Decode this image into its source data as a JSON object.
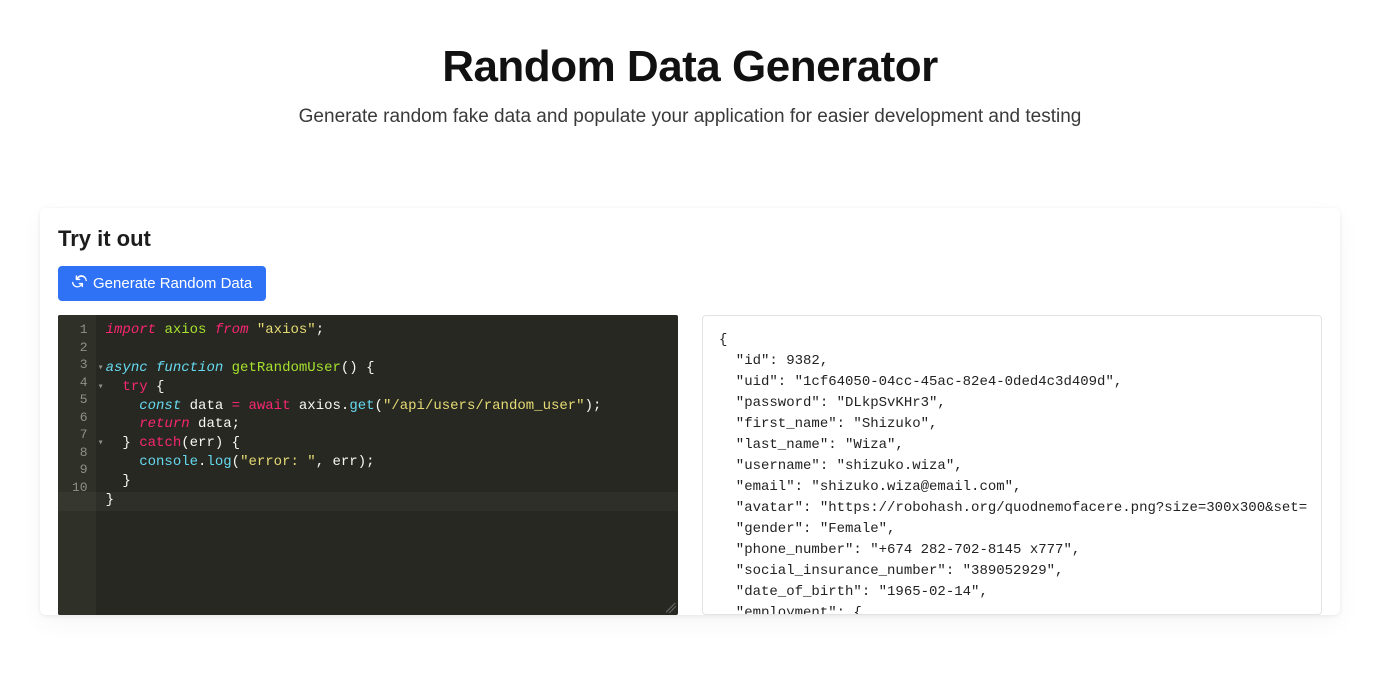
{
  "hero": {
    "title": "Random Data Generator",
    "subtitle": "Generate random fake data and populate your application for easier development and testing"
  },
  "card": {
    "heading": "Try it out",
    "button_label": "Generate Random Data"
  },
  "editor": {
    "line_numbers": "1\n2\n3\n4\n5\n6\n7\n8\n9\n10"
  },
  "code": {
    "l1_import": "import",
    "l1_axios": "axios",
    "l1_from": "from",
    "l1_str": "\"axios\"",
    "l3_async": "async",
    "l3_function": "function",
    "l3_name": "getRandomUser",
    "l4_try": "try",
    "l5_const": "const",
    "l5_data": "data",
    "l5_await": "await",
    "l5_axios": "axios",
    "l5_get": "get",
    "l5_str": "\"/api/users/random_user\"",
    "l6_return": "return",
    "l6_data": "data",
    "l7_catch": "catch",
    "l7_err": "err",
    "l8_console": "console",
    "l8_log": "log",
    "l8_str": "\"error: \"",
    "l8_err": "err"
  },
  "output_json": "{\n  \"id\": 9382,\n  \"uid\": \"1cf64050-04cc-45ac-82e4-0ded4c3d409d\",\n  \"password\": \"DLkpSvKHr3\",\n  \"first_name\": \"Shizuko\",\n  \"last_name\": \"Wiza\",\n  \"username\": \"shizuko.wiza\",\n  \"email\": \"shizuko.wiza@email.com\",\n  \"avatar\": \"https://robohash.org/quodnemofacere.png?size=300x300&set=\n  \"gender\": \"Female\",\n  \"phone_number\": \"+674 282-702-8145 x777\",\n  \"social_insurance_number\": \"389052929\",\n  \"date_of_birth\": \"1965-02-14\",\n  \"employment\": {"
}
